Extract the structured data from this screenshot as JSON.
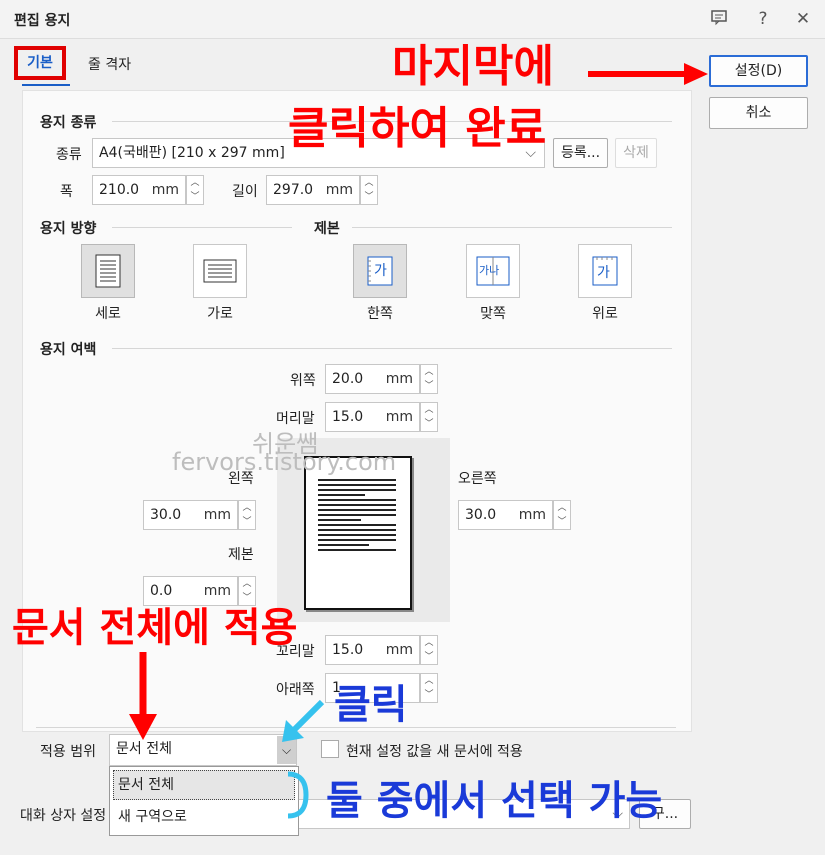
{
  "window": {
    "title": "편집 용지"
  },
  "tabs": [
    {
      "label": "기본"
    },
    {
      "label": "줄 격자"
    }
  ],
  "buttons": {
    "ok": "설정(D)",
    "cancel": "취소",
    "register": "등록...",
    "delete": "삭제"
  },
  "paper_type": {
    "section": "용지 종류",
    "kind_label": "종류",
    "kind_value": "A4(국배판)  [210 x 297 mm]",
    "width_label": "폭",
    "width_value": "210.0",
    "height_label": "길이",
    "height_value": "297.0",
    "unit": "mm"
  },
  "orientation": {
    "section": "용지 방향",
    "options": [
      "세로",
      "가로"
    ],
    "selected": "세로"
  },
  "binding": {
    "section": "제본",
    "options": [
      "한쪽",
      "맞쪽",
      "위로"
    ],
    "selected": "한쪽",
    "glyphs": [
      "가",
      "가나",
      "가"
    ]
  },
  "margins": {
    "section": "용지 여백",
    "top_label": "위쪽",
    "top_value": "20.0",
    "header_label": "머리말",
    "header_value": "15.0",
    "left_label": "왼쪽",
    "left_value": "30.0",
    "right_label": "오른쪽",
    "right_value": "30.0",
    "gutter_label": "제본",
    "gutter_value": "0.0",
    "footer_label": "꼬리말",
    "footer_value": "15.0",
    "bottom_label": "아래쪽",
    "bottom_value": "1",
    "unit": "mm"
  },
  "apply": {
    "label": "적용 범위",
    "value": "문서 전체",
    "dropdown_options": [
      "문서 전체",
      "새 구역으로"
    ],
    "checkbox_label": "현재 설정 값을 새 문서에 적용",
    "dialog_settings_label": "대화 상자 설정",
    "trailing_button": "구..."
  },
  "watermark": {
    "line1": "쉬운쌤",
    "line2": "fervors.tistory.com"
  },
  "annotations": {
    "top_right_1": "마지막에",
    "top_right_2": "클릭하여 완료",
    "apply_all": "문서 전체에 적용",
    "click": "클릭",
    "choose": "둘 중에서 선택 가능"
  },
  "colors": {
    "annotation_red": "#ff0000",
    "annotation_blue": "#1a3ad8",
    "accent": "#2b6cd6"
  }
}
